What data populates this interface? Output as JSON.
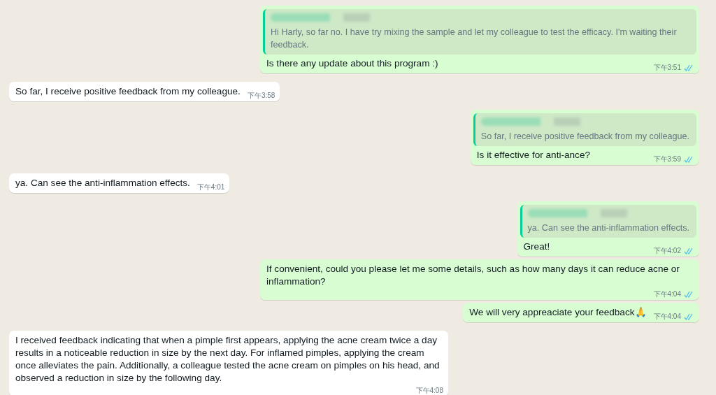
{
  "messages": [
    {
      "kind": "outgoing",
      "quote": {
        "text": "Hi Harly, so far no. I have try mixing the sample and let my colleague to test the efficacy. I'm waiting their feedback."
      },
      "text": "Is there any update about this program :)",
      "time": "下午3:51",
      "read": true
    },
    {
      "kind": "incoming",
      "text": "So far, I receive positive feedback from my colleague.",
      "time": "下午3:58"
    },
    {
      "kind": "outgoing",
      "quote": {
        "text": "So far, I receive positive feedback from my colleague."
      },
      "text": "Is it effective for anti-ance?",
      "time": "下午3:59",
      "read": true
    },
    {
      "kind": "incoming",
      "text": "ya. Can see the anti-inflammation effects.",
      "time": "下午4:01"
    },
    {
      "kind": "outgoing",
      "quote": {
        "text": "ya. Can see the anti-inflammation effects."
      },
      "text": "Great!",
      "time": "下午4:02",
      "read": true
    },
    {
      "kind": "outgoing",
      "text": "If convenient, could you please let me some details, such as how many days it can reduce acne or inflammation?",
      "time": "下午4:04",
      "read": true
    },
    {
      "kind": "outgoing",
      "text": "We will very appreaciate your feedback🙏",
      "time": "下午4:04",
      "read": true
    },
    {
      "kind": "incoming",
      "text": "I received feedback indicating that when a pimple first appears, applying the acne cream twice a day results in a noticeable reduction in size by the next day. For inflamed pimples, applying the cream once alleviates the pain. Additionally, a colleague tested the acne cream on pimples on his head, and observed a reduction in size by the following day.",
      "time": "下午4:08"
    }
  ]
}
